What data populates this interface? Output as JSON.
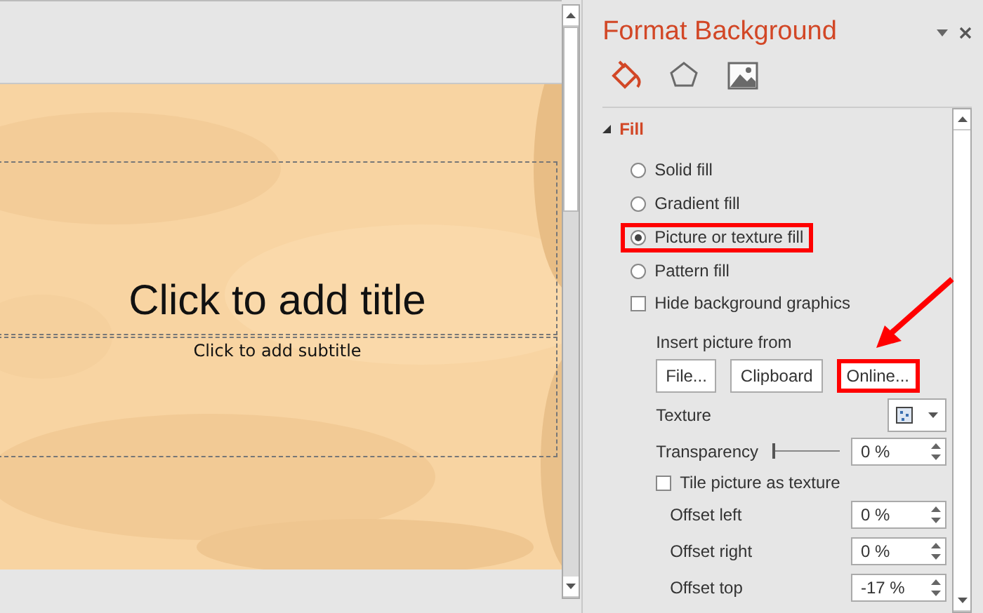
{
  "slide": {
    "kind": "picture",
    "title_placeholder": "Click to add title",
    "subtitle_placeholder": "Click to add subtitle"
  },
  "pane": {
    "title": "Format Background",
    "tabs": [
      {
        "kind": "fill",
        "selected": true
      },
      {
        "kind": "effects",
        "selected": false
      },
      {
        "kind": "picture",
        "selected": false
      }
    ],
    "section": {
      "title": "Fill",
      "expanded": true
    },
    "fill_options": [
      {
        "label": "Solid fill",
        "selected": false,
        "highlighted": false
      },
      {
        "label": "Gradient fill",
        "selected": false,
        "highlighted": false
      },
      {
        "label": "Picture or texture fill",
        "selected": true,
        "highlighted": true
      },
      {
        "label": "Pattern fill",
        "selected": false,
        "highlighted": false
      }
    ],
    "hide_background_graphics": {
      "label": "Hide background graphics",
      "checked": false
    },
    "insert_from": {
      "label": "Insert picture from",
      "buttons": [
        {
          "label": "File...",
          "highlighted": false
        },
        {
          "label": "Clipboard",
          "highlighted": false
        },
        {
          "label": "Online...",
          "highlighted": true
        }
      ]
    },
    "texture": {
      "label": "Texture"
    },
    "transparency": {
      "label": "Transparency",
      "level": 0,
      "value": "0 %"
    },
    "tile": {
      "label": "Tile picture as texture",
      "checked": false
    },
    "offsets": [
      {
        "label": "Offset left",
        "value": "0 %"
      },
      {
        "label": "Offset right",
        "value": "0 %"
      },
      {
        "label": "Offset top",
        "value": "-17 %"
      }
    ]
  }
}
